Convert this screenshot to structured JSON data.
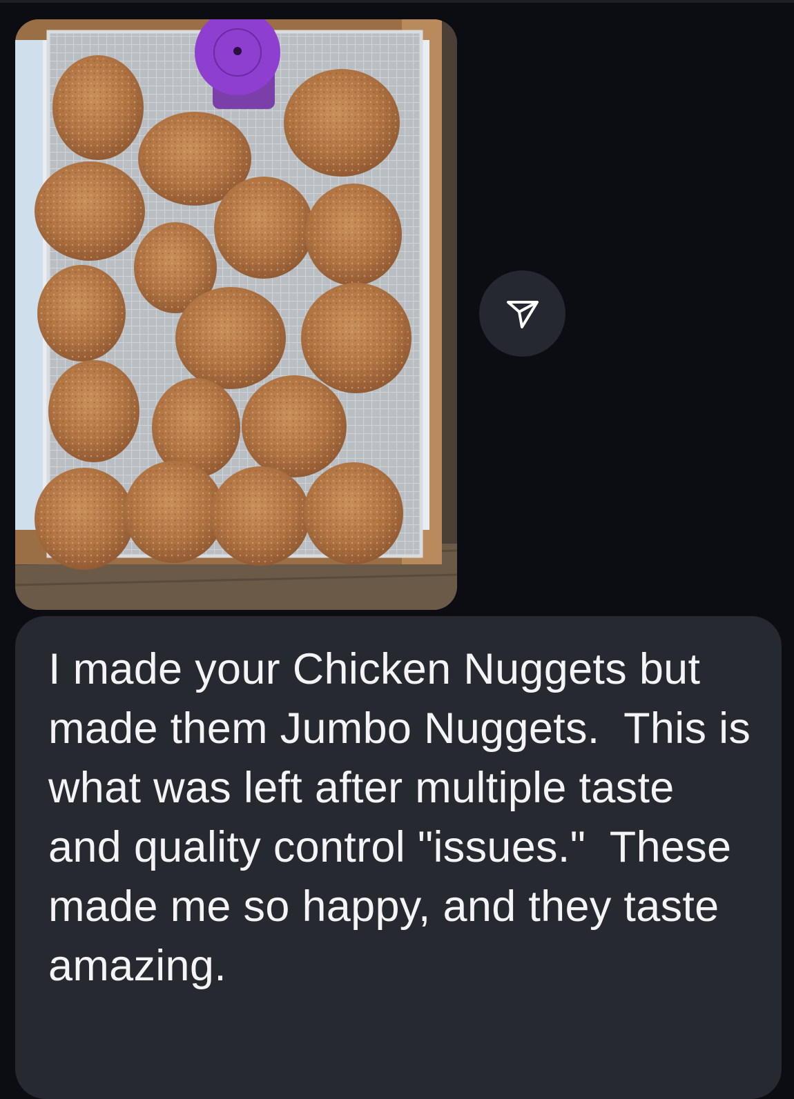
{
  "conversation": {
    "messages": [
      {
        "type": "photo",
        "content": "photo of fried chicken nuggets on a cooling rack"
      },
      {
        "type": "text",
        "text": "I made your Chicken Nuggets but made them Jumbo Nuggets.  This is what was left after multiple taste and quality control \"issues.\"  These made me so happy, and they taste amazing."
      }
    ],
    "share_button": {
      "icon": "paper-plane-icon"
    }
  },
  "colors": {
    "background": "#0b0d12",
    "bubble": "#262930",
    "text": "#f4f4f6",
    "share_button": "#252830"
  }
}
